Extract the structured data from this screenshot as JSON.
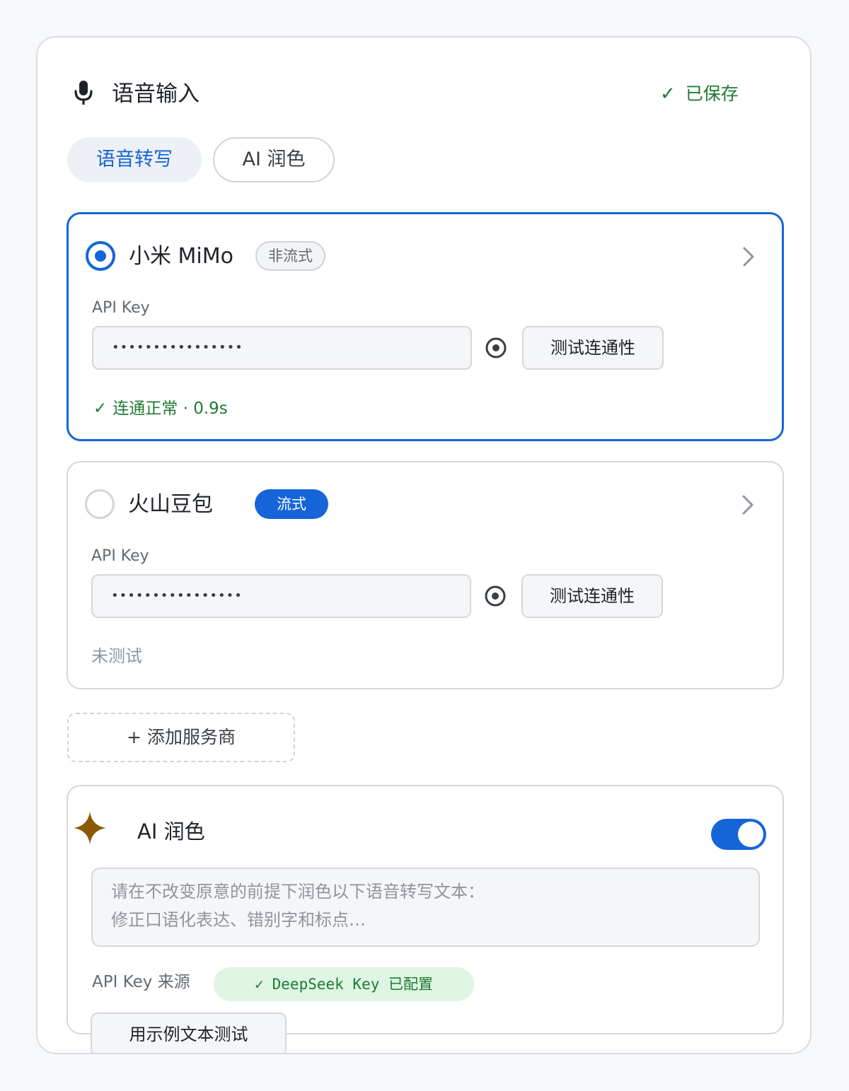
{
  "header": {
    "title": "语音输入",
    "saved_check": "✓",
    "saved_text": "已保存"
  },
  "tabs": [
    {
      "label": "语音转写",
      "active": true
    },
    {
      "label": "AI 润色",
      "active": false
    }
  ],
  "providers": [
    {
      "name": "小米 MiMo",
      "mode": "非流式",
      "selected": true,
      "api_key_label": "API Key",
      "api_key_value": "••••••••••••••••",
      "test_label": "测试连通性",
      "status_check": "✓",
      "status": "连通正常 · 0.9s"
    },
    {
      "name": "火山豆包",
      "mode": "流式",
      "selected": false,
      "api_key_label": "API Key",
      "api_key_value": "••••••••••••••••",
      "test_label": "测试连通性",
      "status": "未测试"
    }
  ],
  "add_provider_label": "+ 添加服务商",
  "ai_polish": {
    "title": "AI 润色",
    "enabled": true,
    "prompt": "请在不改变原意的前提下润色以下语音转写文本：\n修正口语化表达、错别字和标点…",
    "api_source_label": "API Key 来源",
    "api_source_check": "✓",
    "api_source_value": "DeepSeek Key 已配置",
    "sample_test_label": "用示例文本测试"
  },
  "colors": {
    "accent": "#1565d8",
    "success": "#1e7b34",
    "sparkle": "#8a5a00"
  },
  "icons": {
    "mic": "microphone-icon",
    "chevron": "chevron-right-icon",
    "eye": "eye-icon",
    "sparkle": "sparkle-icon"
  }
}
